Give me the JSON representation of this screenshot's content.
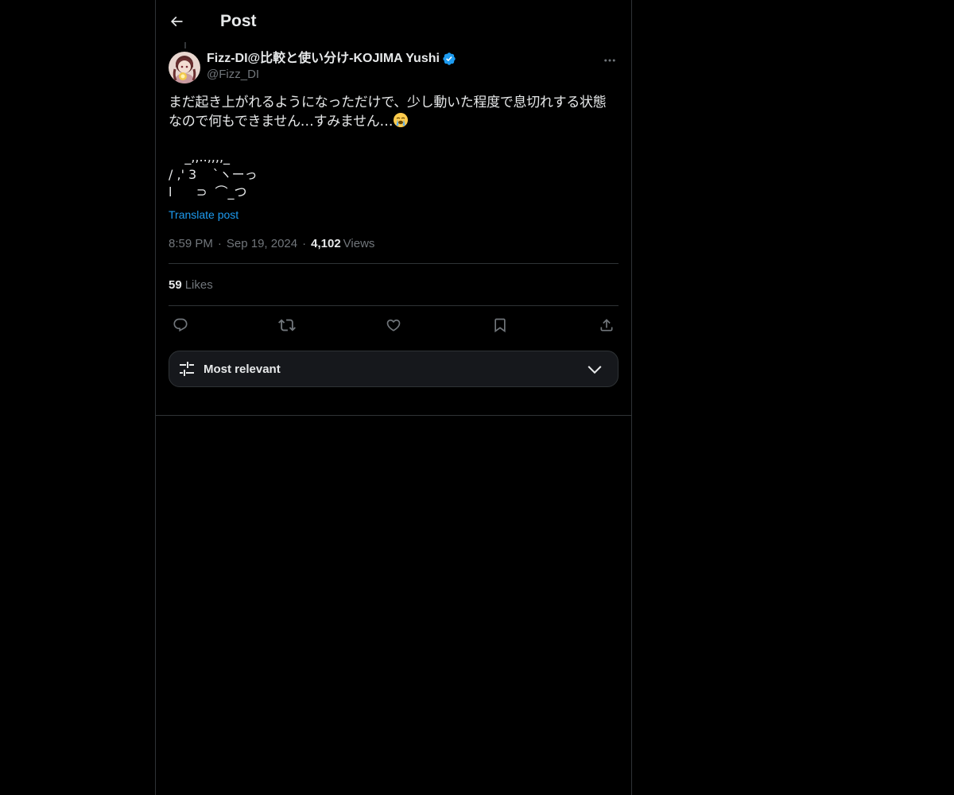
{
  "header": {
    "title": "Post",
    "back_icon": "arrow-left-icon"
  },
  "post": {
    "author": {
      "display_name": "Fizz-DI@比較と使い分け-KOJIMA Yushi",
      "handle": "@Fizz_DI",
      "verified": true,
      "verified_color": "#1d9bf0"
    },
    "text": "まだ起き上がれるようになっただけで、少し動いた程度で息切れする状態なので何もできません…すみません…",
    "text_emoji": "loudly-crying-face-icon",
    "ascii_art": "    _,,..,,,,_\n/ ,' 3    `ヽーっ\nl      ⊃  ⌒_つ\n`'ー---‐'''''\"",
    "translate_label": "Translate post",
    "time": "8:59 PM",
    "separator": "·",
    "date": "Sep 19, 2024",
    "views_count": "4,102",
    "views_label": "Views",
    "likes_count": "59",
    "likes_label": "Likes"
  },
  "actions": [
    {
      "name": "reply-icon"
    },
    {
      "name": "repost-icon"
    },
    {
      "name": "like-icon"
    },
    {
      "name": "bookmark-icon"
    },
    {
      "name": "share-icon"
    }
  ],
  "sort": {
    "label": "Most relevant",
    "icon": "sliders-icon"
  },
  "colors": {
    "background": "#000000",
    "text": "#e7e9ea",
    "muted": "#71767b",
    "accent": "#1d9bf0",
    "border": "#2f3336"
  }
}
